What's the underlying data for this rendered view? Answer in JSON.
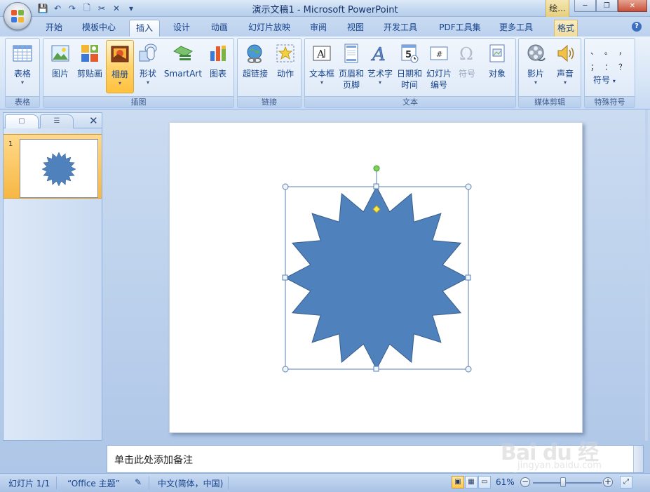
{
  "window": {
    "title": "演示文稿1 - Microsoft PowerPoint",
    "context_tab_header": "绘...",
    "controls": [
      "─",
      "❐",
      "✕"
    ]
  },
  "quick_access": {
    "icons": [
      "save-icon",
      "undo-icon",
      "redo-icon",
      "print-preview-icon",
      "cut-icon",
      "close-icon",
      "customize-icon"
    ],
    "glyphs": [
      "💾",
      "↶",
      "↷",
      "🗋",
      "✂",
      "✕",
      "▾"
    ]
  },
  "tabs": [
    {
      "label": "开始",
      "active": false
    },
    {
      "label": "模板中心",
      "active": false
    },
    {
      "label": "插入",
      "active": true
    },
    {
      "label": "设计",
      "active": false
    },
    {
      "label": "动画",
      "active": false
    },
    {
      "label": "幻灯片放映",
      "active": false
    },
    {
      "label": "审阅",
      "active": false
    },
    {
      "label": "视图",
      "active": false
    },
    {
      "label": "开发工具",
      "active": false
    },
    {
      "label": "PDF工具集",
      "active": false
    },
    {
      "label": "更多工具",
      "active": false
    },
    {
      "label": "格式",
      "active": false,
      "contextual": true
    }
  ],
  "help_glyph": "?",
  "ribbon": {
    "groups": [
      {
        "name": "table",
        "label": "表格",
        "buttons": [
          {
            "label": "表格",
            "has_arrow": true
          }
        ]
      },
      {
        "name": "illustrations",
        "label": "插图",
        "buttons": [
          {
            "label": "图片"
          },
          {
            "label": "剪贴画"
          },
          {
            "label": "相册",
            "has_arrow": true,
            "highlighted": true
          },
          {
            "label": "形状",
            "has_arrow": true
          },
          {
            "label": "SmartArt"
          },
          {
            "label": "图表"
          }
        ]
      },
      {
        "name": "links",
        "label": "链接",
        "buttons": [
          {
            "label": "超链接"
          },
          {
            "label": "动作"
          }
        ]
      },
      {
        "name": "text",
        "label": "文本",
        "buttons": [
          {
            "label": "文本框",
            "has_arrow": true
          },
          {
            "label": "页眉和",
            "label2": "页脚"
          },
          {
            "label": "艺术字",
            "has_arrow": true
          },
          {
            "label": "日期和",
            "label2": "时间"
          },
          {
            "label": "幻灯片",
            "label2": "编号"
          },
          {
            "label": "符号",
            "disabled": true
          },
          {
            "label": "对象"
          }
        ]
      },
      {
        "name": "media",
        "label": "媒体剪辑",
        "buttons": [
          {
            "label": "影片",
            "has_arrow": true
          },
          {
            "label": "声音",
            "has_arrow": true
          }
        ]
      },
      {
        "name": "special-symbols",
        "label": "特殊符号",
        "symbols": [
          "、",
          "。",
          "，",
          "；",
          "：",
          "？"
        ],
        "button": "符号",
        "button_arrow": "▾"
      }
    ]
  },
  "thumbnail_pane": {
    "close_glyph": "✕",
    "slide_number": "1"
  },
  "slide": {
    "shape": "star-16-point",
    "shape_fill": "#4f81bd",
    "shape_stroke": "#385d8a",
    "handle_rotation_color": "#7cd552",
    "handle_adjust_color": "#f8e84c"
  },
  "notes": {
    "placeholder": "单击此处添加备注"
  },
  "statusbar": {
    "slide_info": "幻灯片 1/1",
    "theme": "“Office 主题”",
    "language": "中文(简体，中国)",
    "zoom": "61%",
    "zoom_fraction": 0.44,
    "zoom_minus": "−",
    "zoom_plus": "+"
  },
  "watermark": {
    "brand": "Bai du 经验",
    "url": "jingyan.baidu.com"
  }
}
